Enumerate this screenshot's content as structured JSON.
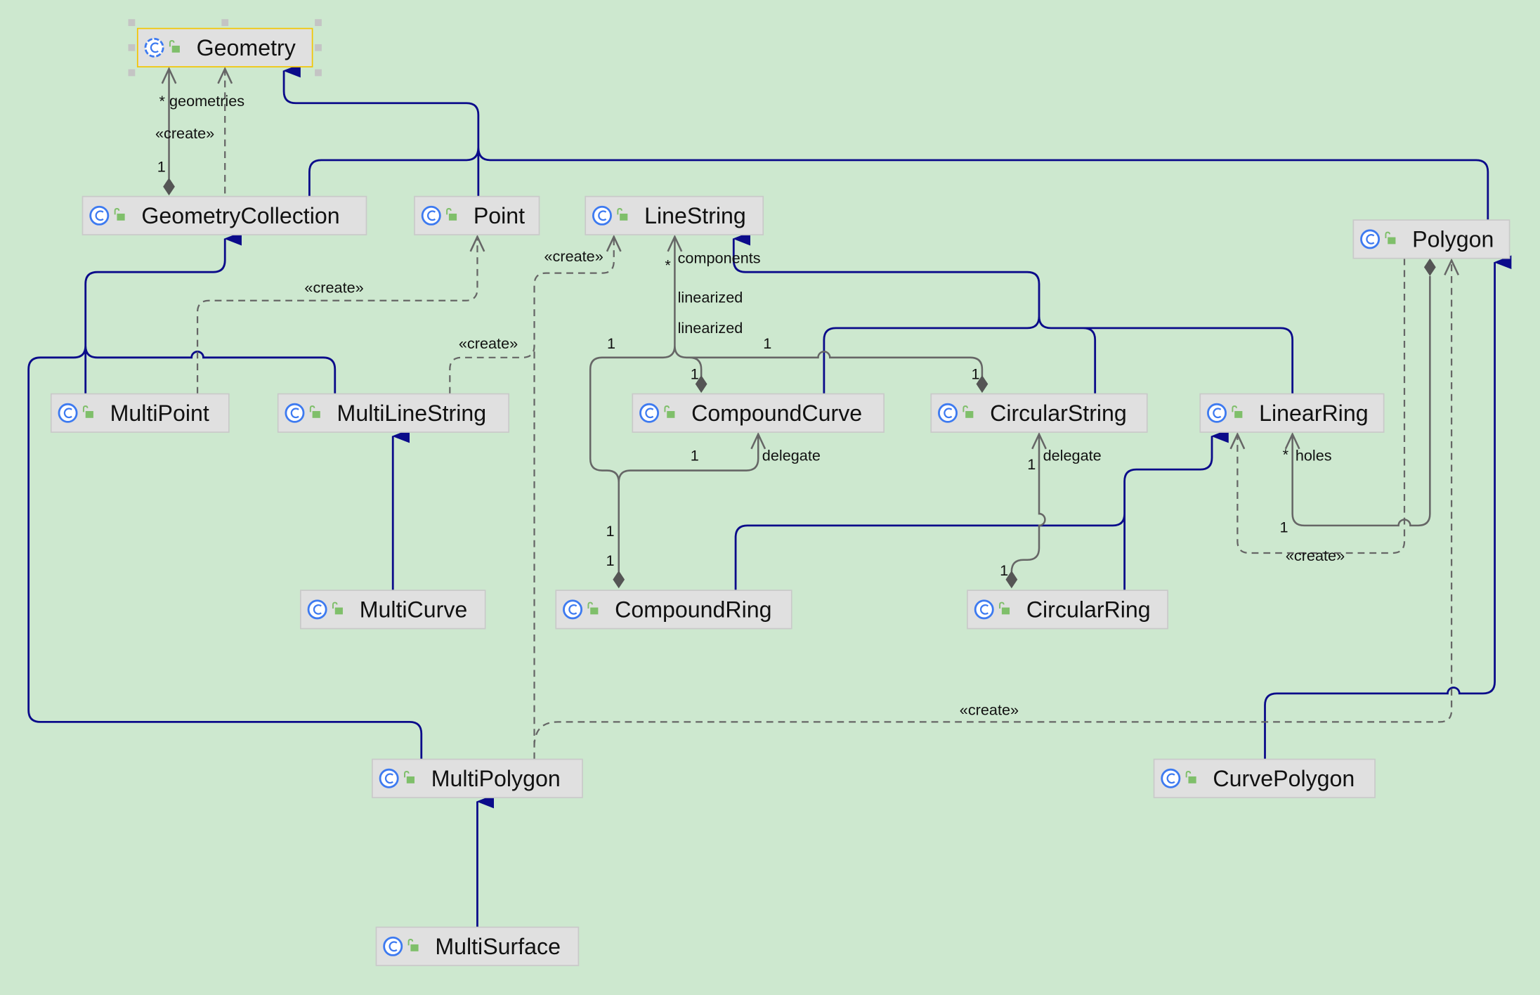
{
  "diagram": {
    "classes": [
      {
        "name": "Geometry",
        "selected": true
      },
      {
        "name": "GeometryCollection"
      },
      {
        "name": "Point"
      },
      {
        "name": "LineString"
      },
      {
        "name": "Polygon"
      },
      {
        "name": "MultiPoint"
      },
      {
        "name": "MultiLineString"
      },
      {
        "name": "CompoundCurve"
      },
      {
        "name": "CircularString"
      },
      {
        "name": "LinearRing"
      },
      {
        "name": "MultiCurve"
      },
      {
        "name": "CompoundRing"
      },
      {
        "name": "CircularRing"
      },
      {
        "name": "MultiPolygon"
      },
      {
        "name": "CurvePolygon"
      },
      {
        "name": "MultiSurface"
      }
    ],
    "class_icon": "class-c-icon",
    "visibility_icon": "public-lock-icon",
    "colors": {
      "background": "#cde8cf",
      "inheritance": "#0b0b8a",
      "association": "#666666",
      "class_icon": "#3d7af0",
      "lock_icon": "#7fbf6a",
      "selection": "#f3c500"
    },
    "edge_labels": [
      "* geometries",
      "«create»",
      "1",
      "«create»",
      "«create»",
      "«create»",
      "*",
      "components",
      "linearized",
      "linearized",
      "1",
      "1",
      "1",
      "1",
      "1",
      "delegate",
      "1",
      "1",
      "1",
      "delegate",
      "1",
      "*",
      "holes",
      "1",
      "«create»",
      "«create»"
    ]
  }
}
